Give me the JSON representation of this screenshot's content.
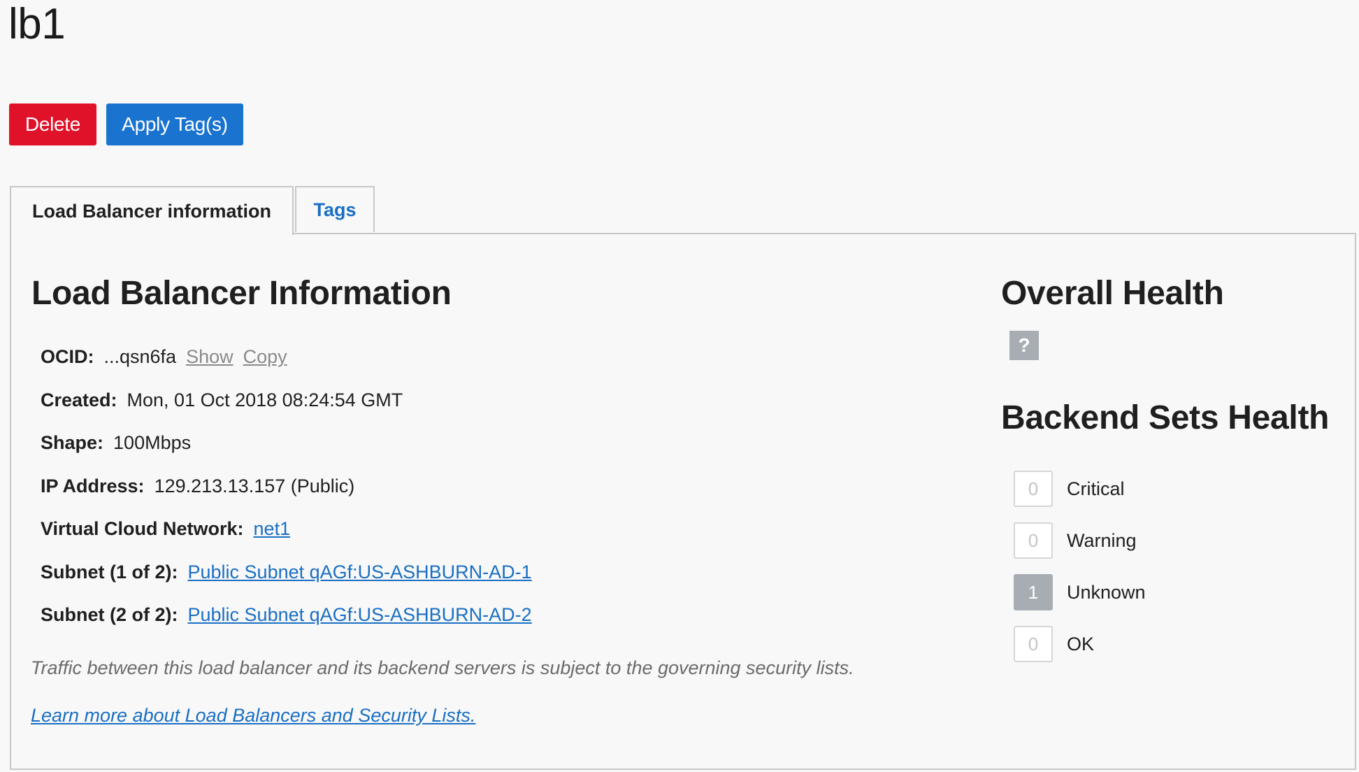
{
  "page": {
    "title": "lb1"
  },
  "actions": {
    "delete_label": "Delete",
    "apply_tags_label": "Apply Tag(s)",
    "delete_color": "#e0122a",
    "apply_tags_color": "#1a73cf"
  },
  "tabs": [
    {
      "label": "Load Balancer information",
      "active": true
    },
    {
      "label": "Tags",
      "active": false
    }
  ],
  "info": {
    "heading": "Load Balancer Information",
    "ocid_label": "OCID:",
    "ocid_value": "...qsn6fa",
    "ocid_show": "Show",
    "ocid_copy": "Copy",
    "created_label": "Created:",
    "created_value": "Mon, 01 Oct 2018 08:24:54 GMT",
    "shape_label": "Shape:",
    "shape_value": "100Mbps",
    "ip_label": "IP Address:",
    "ip_value": "129.213.13.157 (Public)",
    "vcn_label": "Virtual Cloud Network:",
    "vcn_value": "net1",
    "subnet1_label": "Subnet (1 of 2):",
    "subnet1_value": "Public Subnet qAGf:US-ASHBURN-AD-1",
    "subnet2_label": "Subnet (2 of 2):",
    "subnet2_value": "Public Subnet qAGf:US-ASHBURN-AD-2",
    "note": "Traffic between this load balancer and its backend servers is subject to the governing security lists.",
    "learn_more": "Learn more about Load Balancers and Security Lists."
  },
  "health": {
    "overall_heading": "Overall Health",
    "overall_badge": "?",
    "backend_heading": "Backend Sets Health",
    "statuses": [
      {
        "label": "Critical",
        "count": "0",
        "filled": false
      },
      {
        "label": "Warning",
        "count": "0",
        "filled": false
      },
      {
        "label": "Unknown",
        "count": "1",
        "filled": true
      },
      {
        "label": "OK",
        "count": "0",
        "filled": false
      }
    ]
  },
  "colors": {
    "link": "#1a6fc4",
    "badge_gray": "#a8adb3",
    "background": "#f8f8f8"
  }
}
